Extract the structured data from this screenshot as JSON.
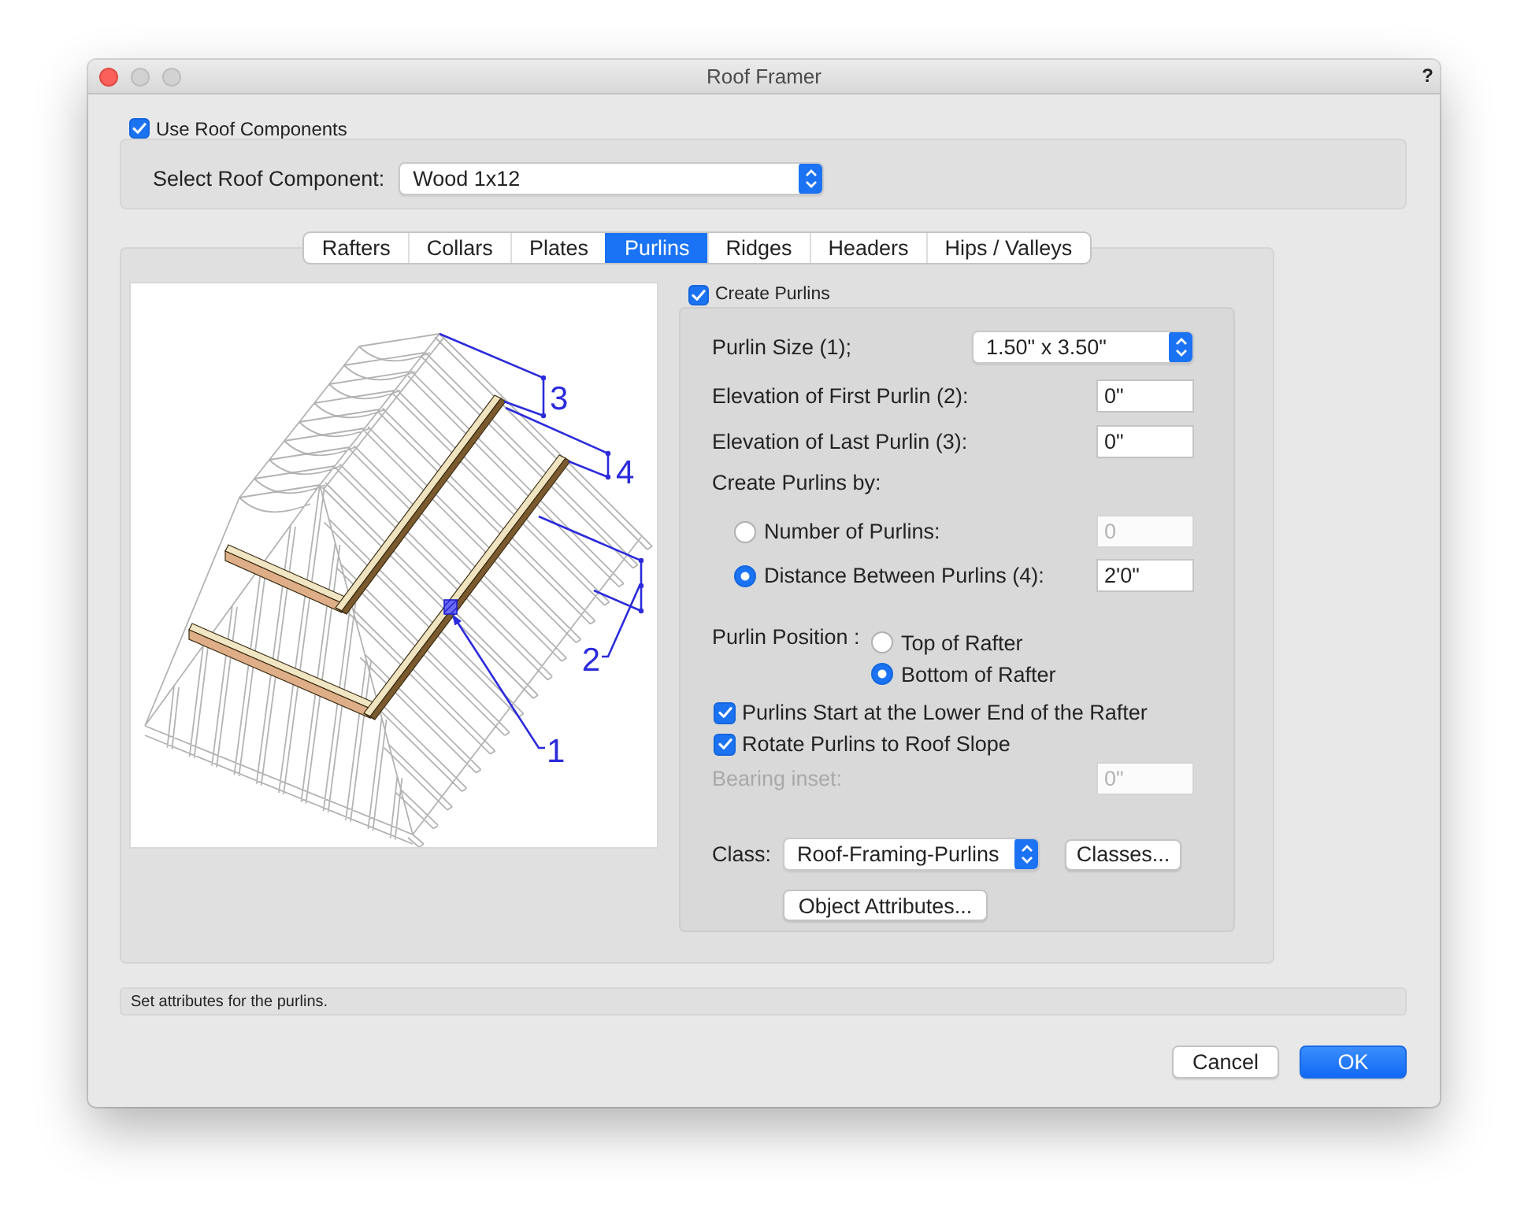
{
  "window": {
    "title": "Roof Framer",
    "help": "?"
  },
  "use_roof_components": {
    "label": "Use Roof Components",
    "checked": true
  },
  "roof_component": {
    "label": "Select Roof Component:",
    "value": "Wood 1x12"
  },
  "tabs": [
    {
      "label": "Rafters",
      "selected": false
    },
    {
      "label": "Collars",
      "selected": false
    },
    {
      "label": "Plates",
      "selected": false
    },
    {
      "label": "Purlins",
      "selected": true
    },
    {
      "label": "Ridges",
      "selected": false
    },
    {
      "label": "Headers",
      "selected": false
    },
    {
      "label": "Hips / Valleys",
      "selected": false
    }
  ],
  "illustration": {
    "callouts": [
      "1",
      "2",
      "3",
      "4"
    ]
  },
  "create_purlins": {
    "label": "Create Purlins",
    "checked": true
  },
  "purlin_size": {
    "label": "Purlin Size (1);",
    "value": "1.50\" x 3.50\""
  },
  "elevations": [
    {
      "label": "Elevation of First Purlin (2):",
      "value": "0\""
    },
    {
      "label": "Elevation of Last Purlin (3):",
      "value": "0\""
    }
  ],
  "create_by": {
    "label": "Create Purlins by:",
    "options": [
      {
        "label": "Number of Purlins:",
        "selected": false,
        "value": "0",
        "disabled": true
      },
      {
        "label": "Distance Between Purlins (4):",
        "selected": true,
        "value": "2'0\"",
        "disabled": false
      }
    ]
  },
  "purlin_position": {
    "label": "Purlin Position :",
    "options": [
      {
        "label": "Top of Rafter",
        "selected": false
      },
      {
        "label": "Bottom of Rafter",
        "selected": true
      }
    ]
  },
  "toggles": [
    {
      "label": "Purlins Start at the Lower End of the Rafter",
      "checked": true
    },
    {
      "label": "Rotate Purlins to Roof Slope",
      "checked": true
    }
  ],
  "bearing_inset": {
    "label": "Bearing inset:",
    "value": "0\"",
    "disabled": true
  },
  "class": {
    "label": "Class:",
    "value": "Roof-Framing-Purlins"
  },
  "panel_buttons": [
    {
      "label": "Classes..."
    },
    {
      "label": "Object Attributes..."
    }
  ],
  "status_bar": {
    "text": "Set attributes for the purlins."
  },
  "buttons": [
    {
      "label": "Cancel",
      "default": false
    },
    {
      "label": "OK",
      "default": true
    }
  ]
}
